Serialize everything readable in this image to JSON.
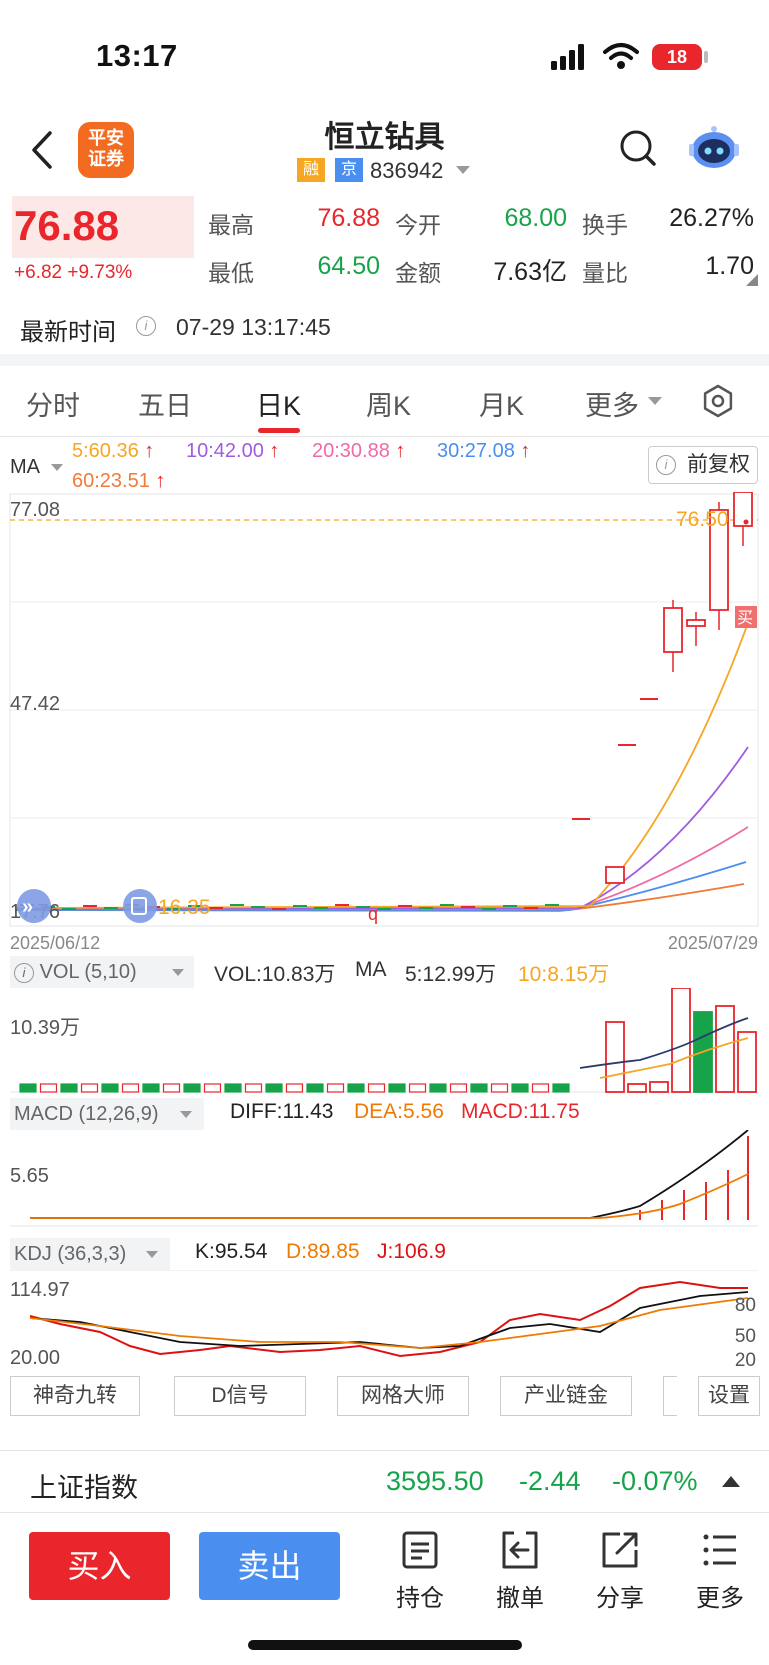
{
  "status": {
    "time": "13:17",
    "battery": "18"
  },
  "header": {
    "broker_logo": [
      "平安",
      "证券"
    ],
    "stock_name": "恒立钻具",
    "tag_margin": "融",
    "tag_exchange": "京",
    "stock_code": "836942"
  },
  "quote": {
    "price": "76.88",
    "change": "+6.82",
    "change_pct": "+9.73%",
    "high_label": "最高",
    "high": "76.88",
    "open_label": "今开",
    "open": "68.00",
    "turnover_label": "换手",
    "turnover": "26.27%",
    "low_label": "最低",
    "low": "64.50",
    "amount_label": "金额",
    "amount": "7.63亿",
    "volume_ratio_label": "量比",
    "volume_ratio": "1.70",
    "time_label": "最新时间",
    "time_value": "07-29 13:17:45"
  },
  "tabs": [
    "分时",
    "五日",
    "日K",
    "周K",
    "月K",
    "更多"
  ],
  "ma": {
    "label": "MA",
    "items": [
      {
        "text": "5:60.36",
        "color": "#f5a623"
      },
      {
        "text": "10:42.00",
        "color": "#a05ce0"
      },
      {
        "text": "20:30.88",
        "color": "#f06aa8"
      },
      {
        "text": "30:27.08",
        "color": "#4a8ff0"
      },
      {
        "text": "60:23.51",
        "color": "#f07a3a"
      }
    ],
    "arrow": "↑",
    "adjust_label": "前复权",
    "info_glyph": "i"
  },
  "kline": {
    "y_top_label": "77.08",
    "y_mid_label": "47.42",
    "y_low_label": "17.76",
    "min_label": "16.35",
    "max_label": "76.50",
    "date_start": "2025/06/12",
    "date_end": "2025/07/29",
    "buy_marker": "买",
    "q_marker": "q"
  },
  "volume": {
    "label": "VOL (5,10)",
    "vol": "VOL:10.83万",
    "ma_label": "MA",
    "ma5": "5:12.99万",
    "ma10": "10:8.15万",
    "y_label": "10.39万"
  },
  "macd": {
    "label": "MACD (12,26,9)",
    "diff": "DIFF:11.43",
    "dea": "DEA:5.56",
    "macd": "MACD:11.75",
    "y_label": "5.65"
  },
  "kdj": {
    "label": "KDJ (36,3,3)",
    "k": "K:95.54",
    "d": "D:89.85",
    "j": "J:106.9",
    "y_top": "114.97",
    "y_bottom": "20.00",
    "right_labels": [
      "80",
      "50",
      "20"
    ]
  },
  "tools": [
    "神奇九转",
    "D信号",
    "网格大师",
    "产业链金",
    "设置"
  ],
  "index": {
    "name": "上证指数",
    "value": "3595.50",
    "change": "-2.44",
    "pct": "-0.07%"
  },
  "actions": {
    "buy": "买入",
    "sell": "卖出",
    "position": "持仓",
    "cancel": "撤单",
    "share": "分享",
    "more": "更多"
  },
  "colors": {
    "up": "#e8262b",
    "down": "#17a34a",
    "sell": "#4a8ff0",
    "logo": "#f26b21"
  }
}
